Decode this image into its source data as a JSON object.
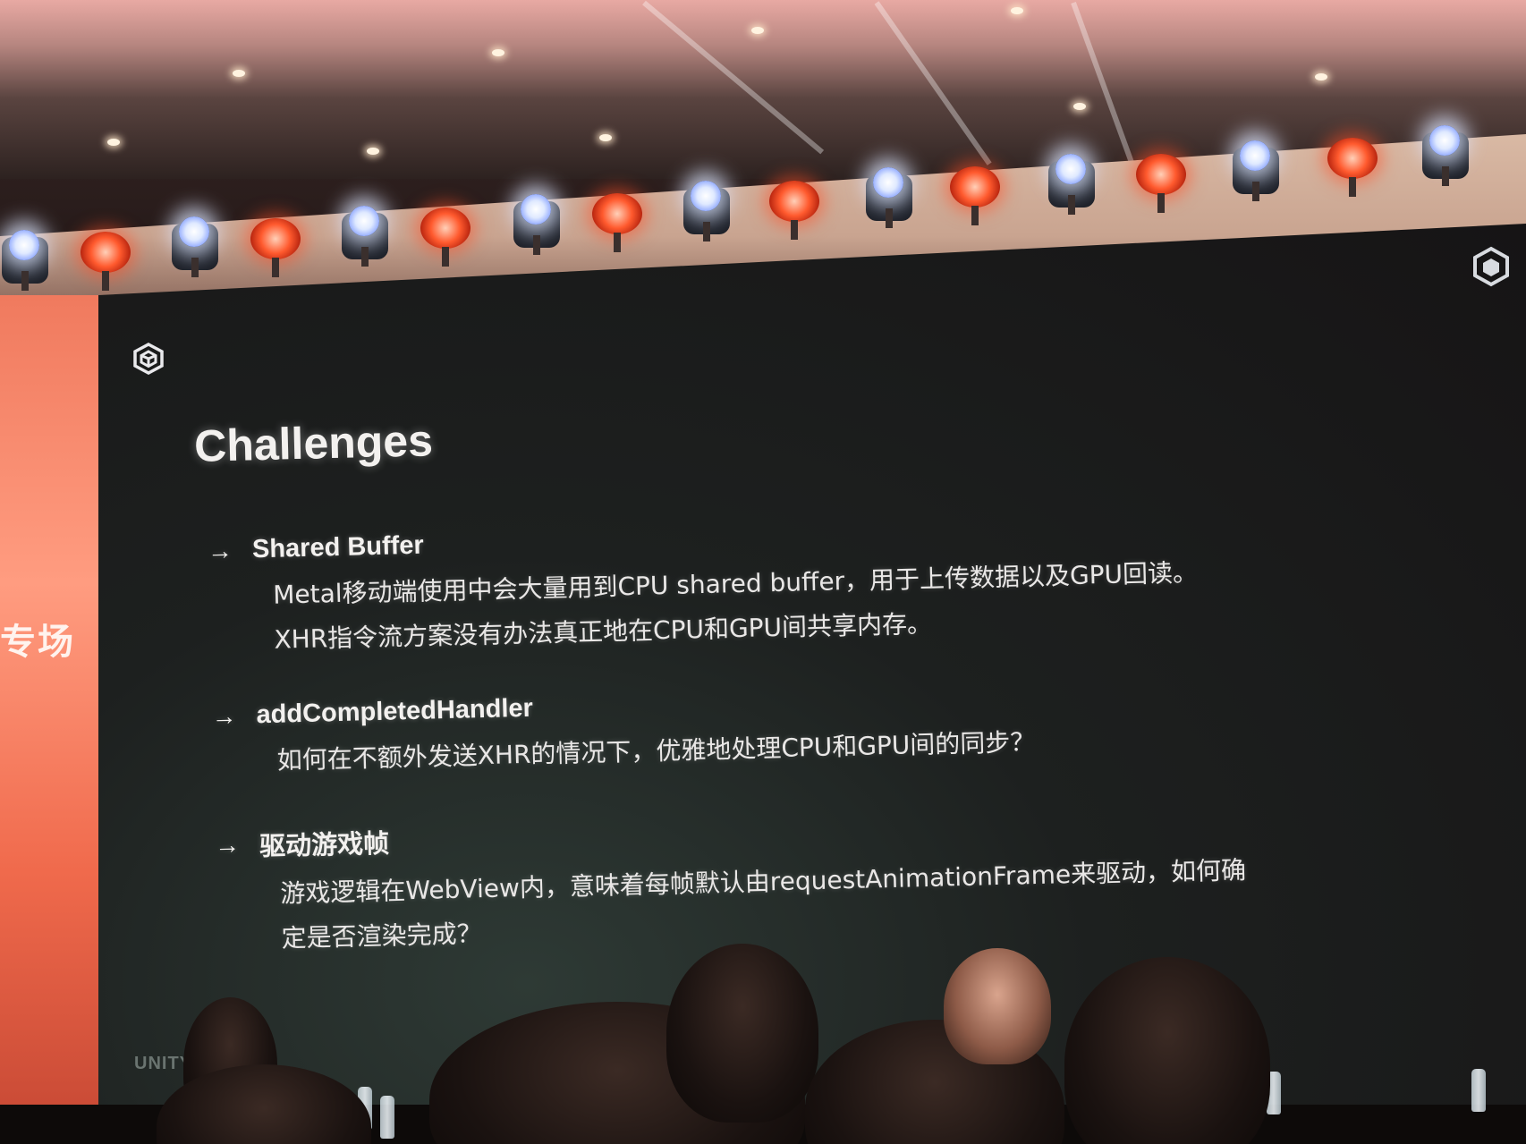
{
  "slide": {
    "title": "Challenges",
    "items": [
      {
        "heading": "Shared Buffer",
        "lines": [
          "Metal移动端使用中会大量用到CPU shared buffer，用于上传数据以及GPU回读。",
          "XHR指令流方案没有办法真正地在CPU和GPU间共享内存。"
        ]
      },
      {
        "heading": "addCompletedHandler",
        "lines": [
          "如何在不额外发送XHR的情况下，优雅地处理CPU和GPU间的同步？"
        ]
      },
      {
        "heading": "驱动游戏帧",
        "lines": [
          "游戏逻辑在WebView内，意味着每帧默认由requestAnimationFrame来驱动，如何确",
          "定是否渲染完成？"
        ]
      }
    ],
    "footer_wordmark": "UNITY"
  },
  "banner": {
    "partial_text": "专场"
  },
  "icons": {
    "slide_logo": "unity-cube-icon",
    "corner_logo": "unity-cube-icon",
    "bullet": "arrow-right-icon"
  },
  "colors": {
    "screen_bg": "#161415",
    "text": "#f3f1ef",
    "banner": "#f07a5e",
    "wash_light": "#ff5a2e",
    "spot_light": "#dfe9ff"
  }
}
